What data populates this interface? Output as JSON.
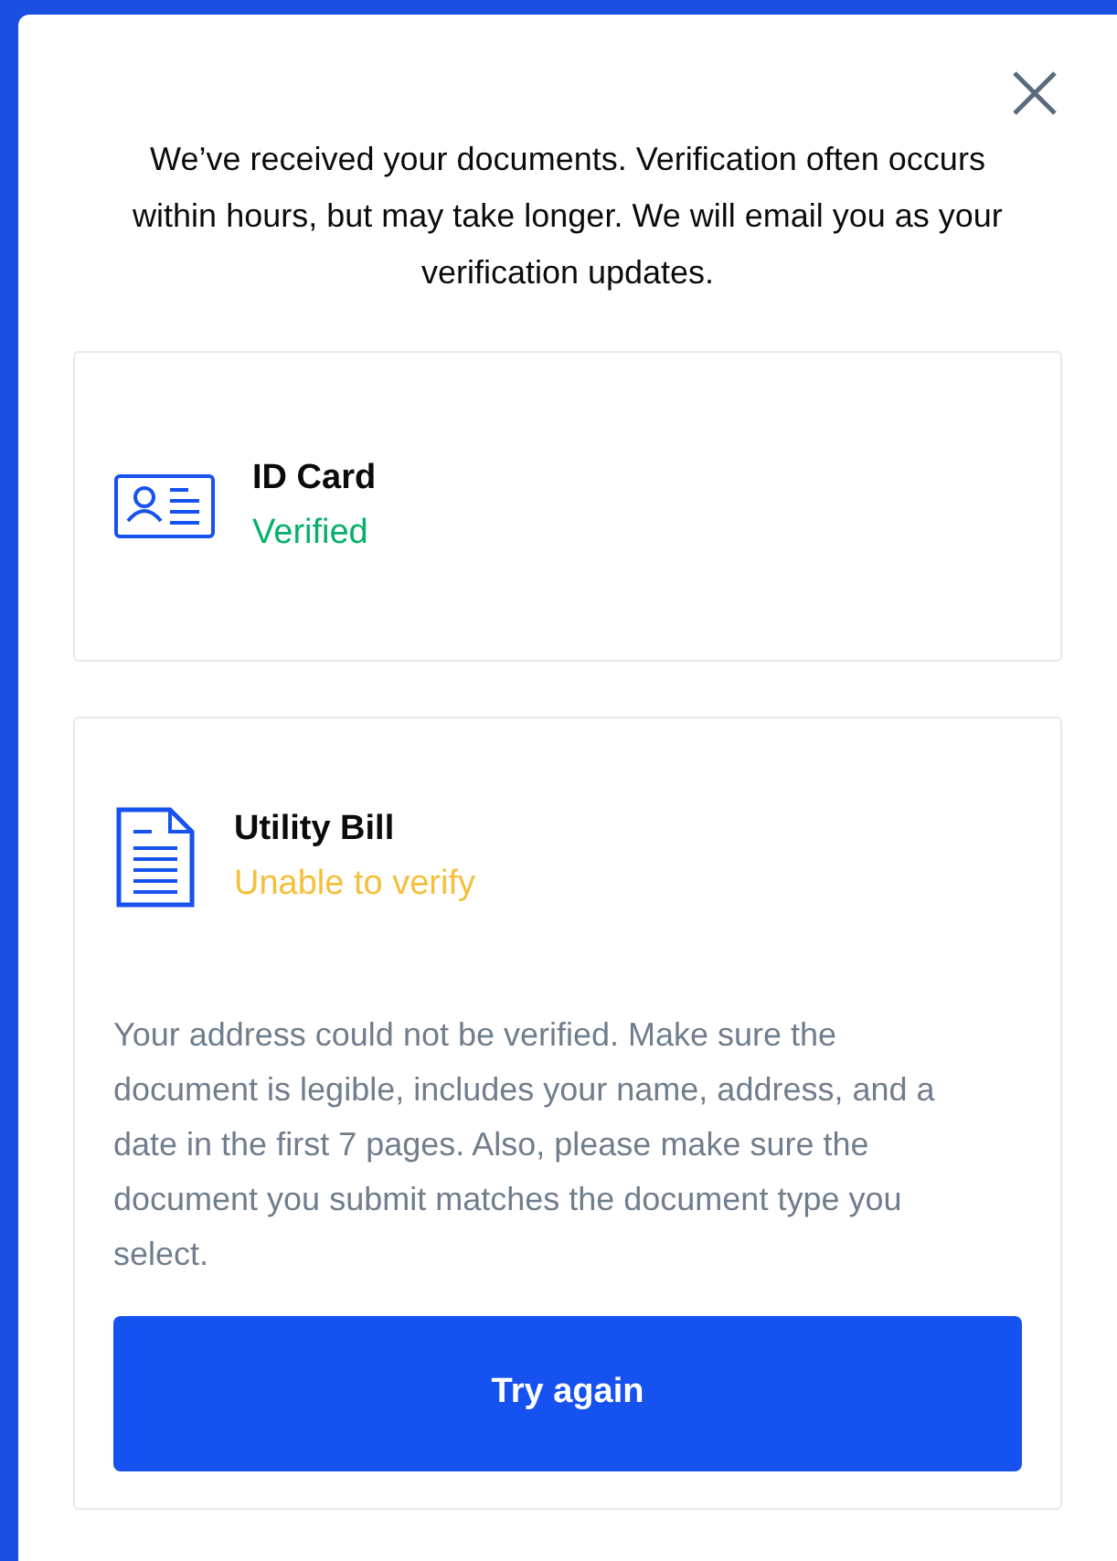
{
  "intro": "We’ve received your documents. Verification often occurs within hours, but may take longer. We will email you as your verification updates.",
  "documents": [
    {
      "kind": "id_card",
      "title": "ID Card",
      "status": "Verified",
      "color": "#05b169"
    },
    {
      "kind": "document",
      "title": "Utility Bill",
      "status": "Unable to verify",
      "color": "#f4c03c",
      "message": "Your address could not be verified. Make sure the document is legible, includes your name, address, and a date in the first 7 pages. Also, please make sure the document you submit matches the document type you select.",
      "action": "Try again"
    }
  ]
}
